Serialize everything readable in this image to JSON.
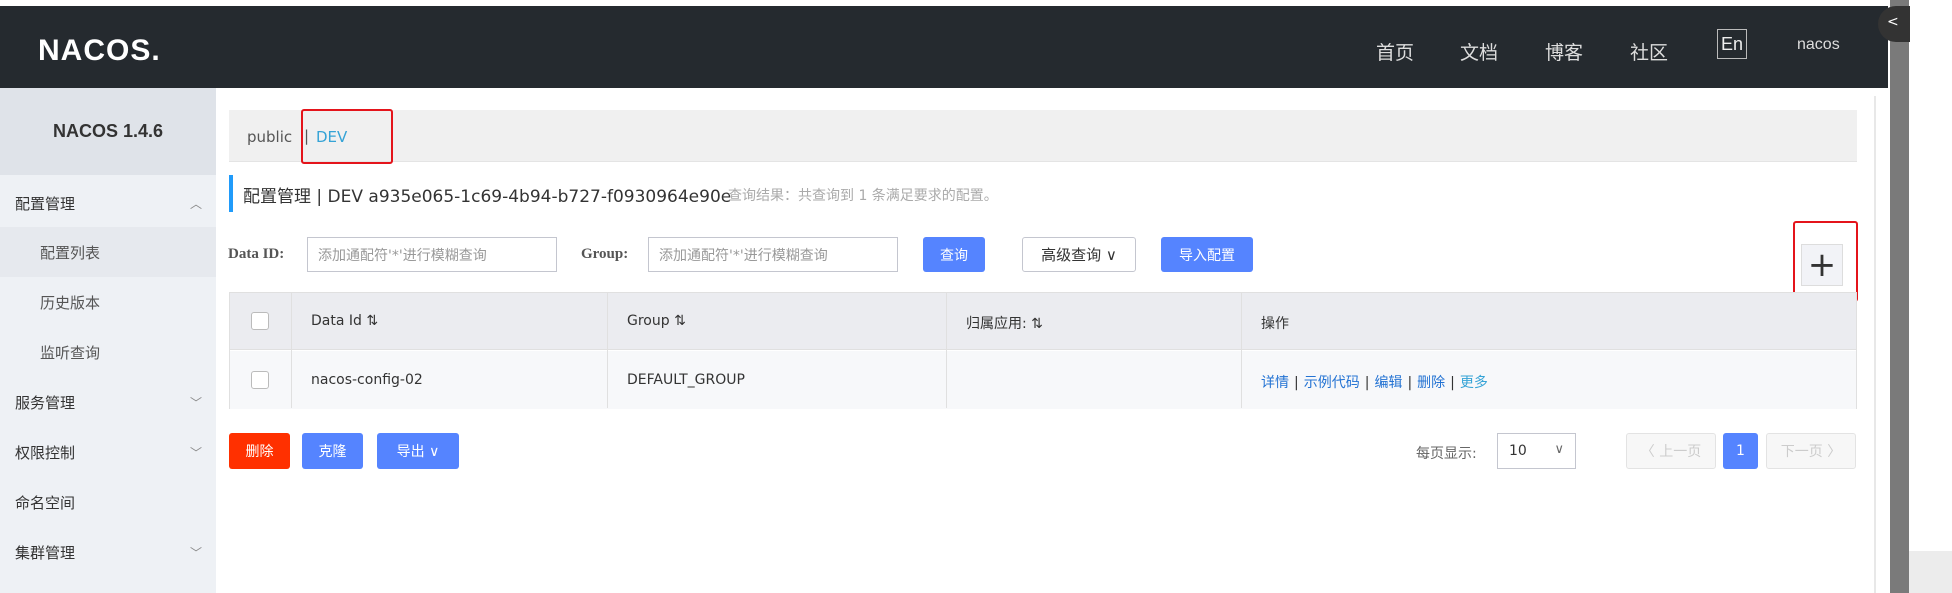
{
  "header": {
    "logo": "NACOS.",
    "nav": [
      "首页",
      "文档",
      "博客",
      "社区"
    ],
    "lang": "En",
    "user": "nacos",
    "bg_color": "#252a2f"
  },
  "sidebar": {
    "version": "NACOS 1.4.6",
    "items": [
      {
        "label": "配置管理",
        "expanded": true
      },
      {
        "label": "配置列表",
        "sub": true,
        "active": true
      },
      {
        "label": "历史版本",
        "sub": true
      },
      {
        "label": "监听查询",
        "sub": true
      },
      {
        "label": "服务管理",
        "expanded": false
      },
      {
        "label": "权限控制",
        "expanded": false
      },
      {
        "label": "命名空间"
      },
      {
        "label": "集群管理",
        "expanded": false
      }
    ]
  },
  "namespaces": {
    "public": "public",
    "separator": "|",
    "dev": "DEV"
  },
  "title": {
    "main": "配置管理  |  DEV  a935e065-1c69-4b94-b727-f0930964e90e",
    "result": "查询结果：共查询到 1 条满足要求的配置。"
  },
  "search": {
    "data_id_label": "Data ID:",
    "data_id_placeholder": "添加通配符'*'进行模糊查询",
    "group_label": "Group:",
    "group_placeholder": "添加通配符'*'进行模糊查询",
    "query_btn": "查询",
    "advanced_btn": "高级查询 ∨",
    "import_btn": "导入配置",
    "plus": "+"
  },
  "table": {
    "headers": [
      "Data Id ⇅",
      "Group ⇅",
      "归属应用: ⇅",
      "操作"
    ],
    "rows": [
      {
        "data_id": "nacos-config-02",
        "group": "DEFAULT_GROUP",
        "app": "",
        "actions": {
          "detail": "详情",
          "sample": "示例代码",
          "edit": "编辑",
          "delete": "删除",
          "more": "更多"
        }
      }
    ]
  },
  "footer": {
    "delete_btn": "删除",
    "clone_btn": "克隆",
    "export_btn": "导出 ∨",
    "page_size_label": "每页显示:",
    "page_size": "10",
    "prev": "〈 上一页",
    "current_page": "1",
    "next": "下一页 〉"
  },
  "colors": {
    "primary": "#5584ff",
    "danger": "#ff3000",
    "link": "#2473d3",
    "highlight_box": "#e4141b"
  }
}
